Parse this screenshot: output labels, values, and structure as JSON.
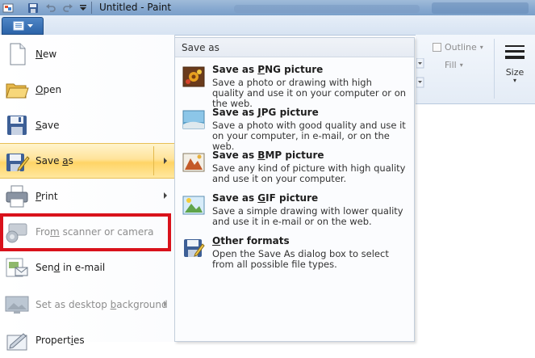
{
  "window": {
    "title": "Untitled - Paint"
  },
  "ribbon": {
    "outline_label": "Outline",
    "fill_label": "Fill",
    "size_label": "Size"
  },
  "file_menu": {
    "items": [
      {
        "label_pre": "",
        "mnemonic": "N",
        "label_post": "ew",
        "icon": "new-document-icon",
        "enabled": true,
        "submenu": false
      },
      {
        "label_pre": "",
        "mnemonic": "O",
        "label_post": "pen",
        "icon": "open-folder-icon",
        "enabled": true,
        "submenu": false
      },
      {
        "label_pre": "",
        "mnemonic": "S",
        "label_post": "ave",
        "icon": "save-floppy-icon",
        "enabled": true,
        "submenu": false
      },
      {
        "label_pre": "Save ",
        "mnemonic": "a",
        "label_post": "s",
        "icon": "save-as-icon",
        "enabled": true,
        "submenu": true,
        "highlighted": true
      },
      {
        "label_pre": "",
        "mnemonic": "P",
        "label_post": "rint",
        "icon": "printer-icon",
        "enabled": true,
        "submenu": true
      },
      {
        "label_pre": "Fro",
        "mnemonic": "m",
        "label_post": " scanner or camera",
        "icon": "scanner-camera-icon",
        "enabled": false,
        "submenu": false
      },
      {
        "label_pre": "Sen",
        "mnemonic": "d",
        "label_post": " in e-mail",
        "icon": "email-icon",
        "enabled": true,
        "submenu": false
      },
      {
        "label_pre": "Set as desktop ",
        "mnemonic": "b",
        "label_post": "ackground",
        "icon": "desktop-background-icon",
        "enabled": false,
        "submenu": true
      },
      {
        "label_pre": "Propert",
        "mnemonic": "i",
        "label_post": "es",
        "icon": "properties-icon",
        "enabled": true,
        "submenu": false
      }
    ]
  },
  "save_as_menu": {
    "heading": "Save as",
    "items": [
      {
        "title_pre": "Save as ",
        "mnemonic": "P",
        "title_post": "NG picture",
        "description": "Save a photo or drawing with high quality and use it on your computer or on the web.",
        "icon": "png-picture-icon"
      },
      {
        "title_pre": "Save as ",
        "mnemonic": "J",
        "title_post": "PG picture",
        "description": "Save a photo with good quality and use it on your computer, in e-mail, or on the web.",
        "icon": "jpg-picture-icon"
      },
      {
        "title_pre": "Save as ",
        "mnemonic": "B",
        "title_post": "MP picture",
        "description": "Save any kind of picture with high quality and use it on your computer.",
        "icon": "bmp-picture-icon"
      },
      {
        "title_pre": "Save as ",
        "mnemonic": "G",
        "title_post": "IF picture",
        "description": "Save a simple drawing with lower quality and use it in e-mail or on the web.",
        "icon": "gif-picture-icon"
      },
      {
        "title_pre": "",
        "mnemonic": "O",
        "title_post": "ther formats",
        "description": "Open the Save As dialog box to select from all possible file types.",
        "icon": "other-formats-icon"
      }
    ]
  },
  "colors": {
    "highlight": "#ffe39a",
    "annotation_red": "#d9121b",
    "app_button": "#2b63a8"
  }
}
